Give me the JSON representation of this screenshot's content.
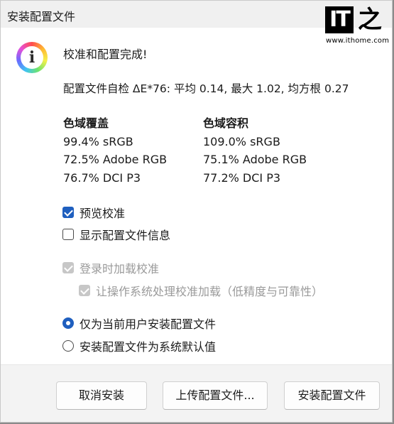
{
  "window": {
    "title": "安装配置文件"
  },
  "watermark": {
    "logo_text": "IT",
    "logo_glyph": "之",
    "url": "www.ithome.com"
  },
  "message": {
    "icon": "info-icon",
    "heading": "校准和配置完成!",
    "self_check": "配置文件自检 ΔE*76: 平均 0.14, 最大 1.02, 均方根 0.27"
  },
  "gamut_coverage": {
    "title": "色域覆盖",
    "rows": [
      "99.4% sRGB",
      "72.5% Adobe RGB",
      "76.7% DCI P3"
    ]
  },
  "gamut_volume": {
    "title": "色域容积",
    "rows": [
      "109.0% sRGB",
      "75.1% Adobe RGB",
      "77.2% DCI P3"
    ]
  },
  "options": {
    "preview": {
      "label": "预览校准",
      "checked": true
    },
    "show_info": {
      "label": "显示配置文件信息",
      "checked": false
    },
    "load_login": {
      "label": "登录时加载校准",
      "checked": true,
      "disabled": true
    },
    "os_load": {
      "label": "让操作系统处理校准加载（低精度与可靠性）",
      "checked": true,
      "disabled": true
    }
  },
  "scope": {
    "current_user": {
      "label": "仅为当前用户安装配置文件",
      "selected": true
    },
    "system_default": {
      "label": "安装配置文件为系统默认值",
      "selected": false
    }
  },
  "buttons": {
    "cancel": "取消安装",
    "upload": "上传配置文件...",
    "install": "安装配置文件"
  }
}
